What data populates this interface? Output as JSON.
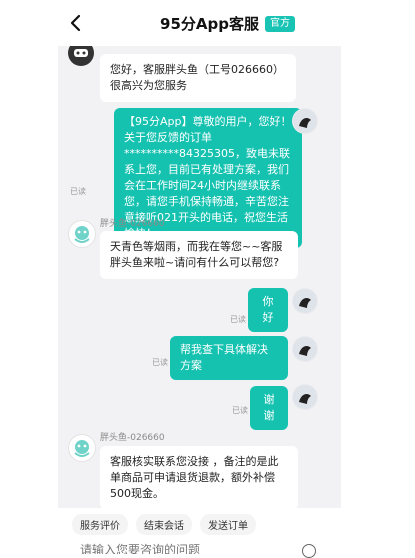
{
  "header": {
    "title": "95分App客服",
    "badge": "官方"
  },
  "messages": {
    "m1": {
      "text": "您好，客服胖头鱼（工号026660）很高兴为您服务"
    },
    "m2": {
      "text": "【95分App】尊敬的用户，您好！关于您反馈的订单**********84325305，致电未联系上您，目前已有处理方案，我们会在工作时间24小时内继续联系您，请您手机保持畅通，辛苦您注意接听021开头的电话，祝您生活愉快！",
      "status": "已读"
    },
    "m3": {
      "sender": "胖头鱼-026660",
      "text": "天青色等烟雨，而我在等您~~客服胖头鱼来啦~请问有什么可以帮您?"
    },
    "m4": {
      "text": "你好",
      "status": "已读"
    },
    "m5": {
      "text": "帮我查下具体解决方案",
      "status": "已读"
    },
    "m6": {
      "text": "谢谢",
      "status": "已读"
    },
    "m7": {
      "sender": "胖头鱼-026660",
      "text": "客服核实联系您没接 ，备注的是此单商品可申请退货退款，额外补偿500现金。"
    }
  },
  "toolbar": {
    "rate": "服务评价",
    "end": "结束会话",
    "send_order": "发送订单"
  },
  "input": {
    "placeholder": "请输入您要咨询的问题"
  },
  "icons": [
    "back-arrow-icon",
    "agent-avatar",
    "user-avatar",
    "plus-icon"
  ],
  "colors": {
    "accent": "#15c2b0",
    "chat_bg": "#f2f2f4"
  }
}
